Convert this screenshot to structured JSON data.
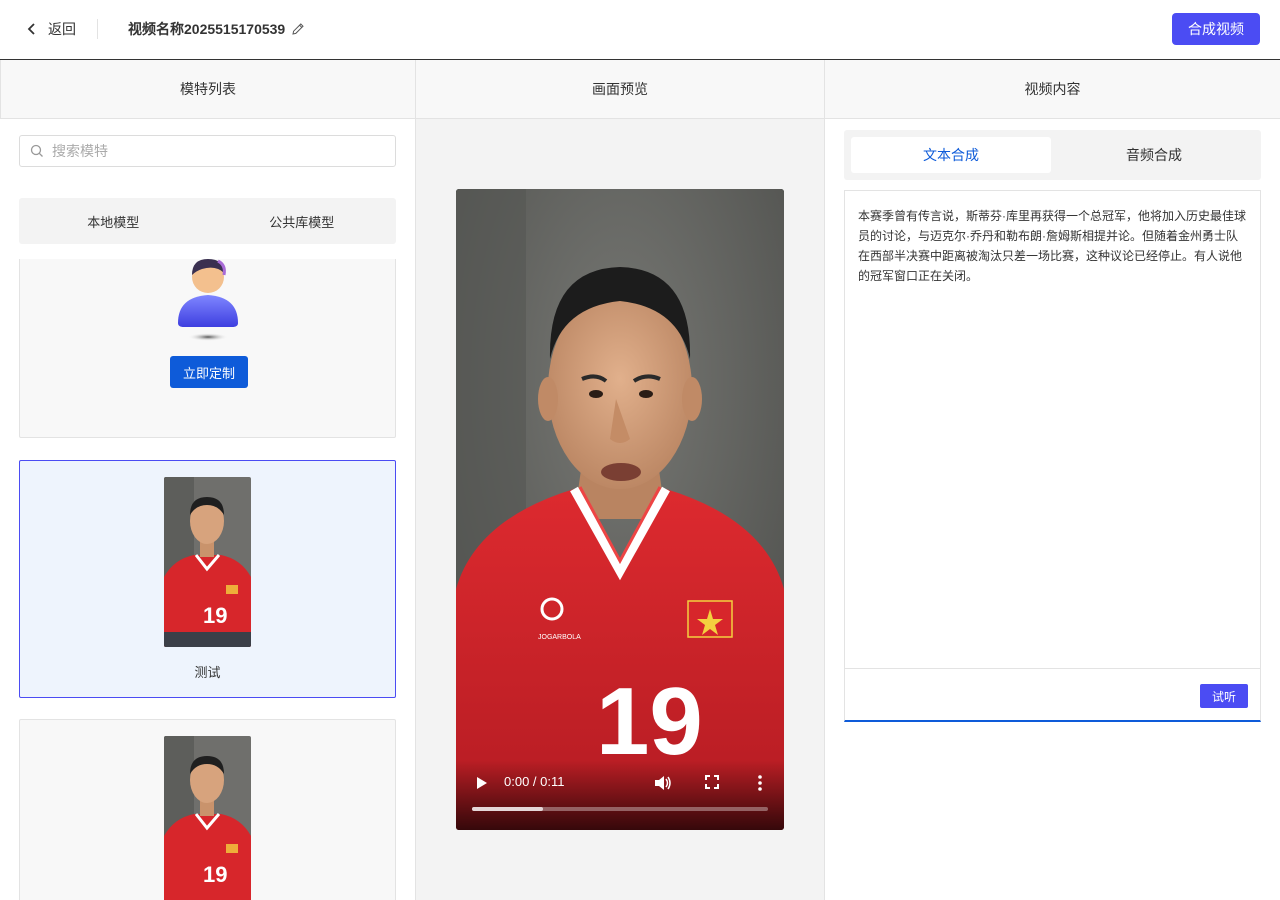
{
  "header": {
    "back_label": "返回",
    "video_title": "视频名称2025515170539",
    "compose_button": "合成视频"
  },
  "columns": {
    "left_title": "模特列表",
    "middle_title": "画面预览",
    "right_title": "视频内容"
  },
  "models": {
    "search_placeholder": "搜索模特",
    "tabs": [
      "本地模型",
      "公共库模型"
    ],
    "custom_button": "立即定制",
    "cards": [
      {
        "name": "测试",
        "selected": true
      },
      {
        "name": "",
        "selected": false
      }
    ]
  },
  "preview": {
    "time": "0:00 / 0:11",
    "progress": 0.24
  },
  "content": {
    "tabs": [
      "文本合成",
      "音频合成"
    ],
    "active_tab": "文本合成",
    "text": "本赛季曾有传言说，斯蒂芬·库里再获得一个总冠军，他将加入历史最佳球员的讨论，与迈克尔·乔丹和勒布朗·詹姆斯相提并论。但随着金州勇士队在西部半决赛中距离被淘汰只差一场比赛，这种议论已经停止。有人说他的冠军窗口正在关闭。",
    "listen_button": "试听"
  },
  "colors": {
    "primary": "#4b4cf3",
    "blue": "#0e5bd9",
    "jersey_red": "#d7262b"
  },
  "icons": [
    "chevron-left-icon",
    "pencil-icon",
    "search-icon",
    "play-icon",
    "volume-icon",
    "fullscreen-icon",
    "more-vertical-icon"
  ]
}
